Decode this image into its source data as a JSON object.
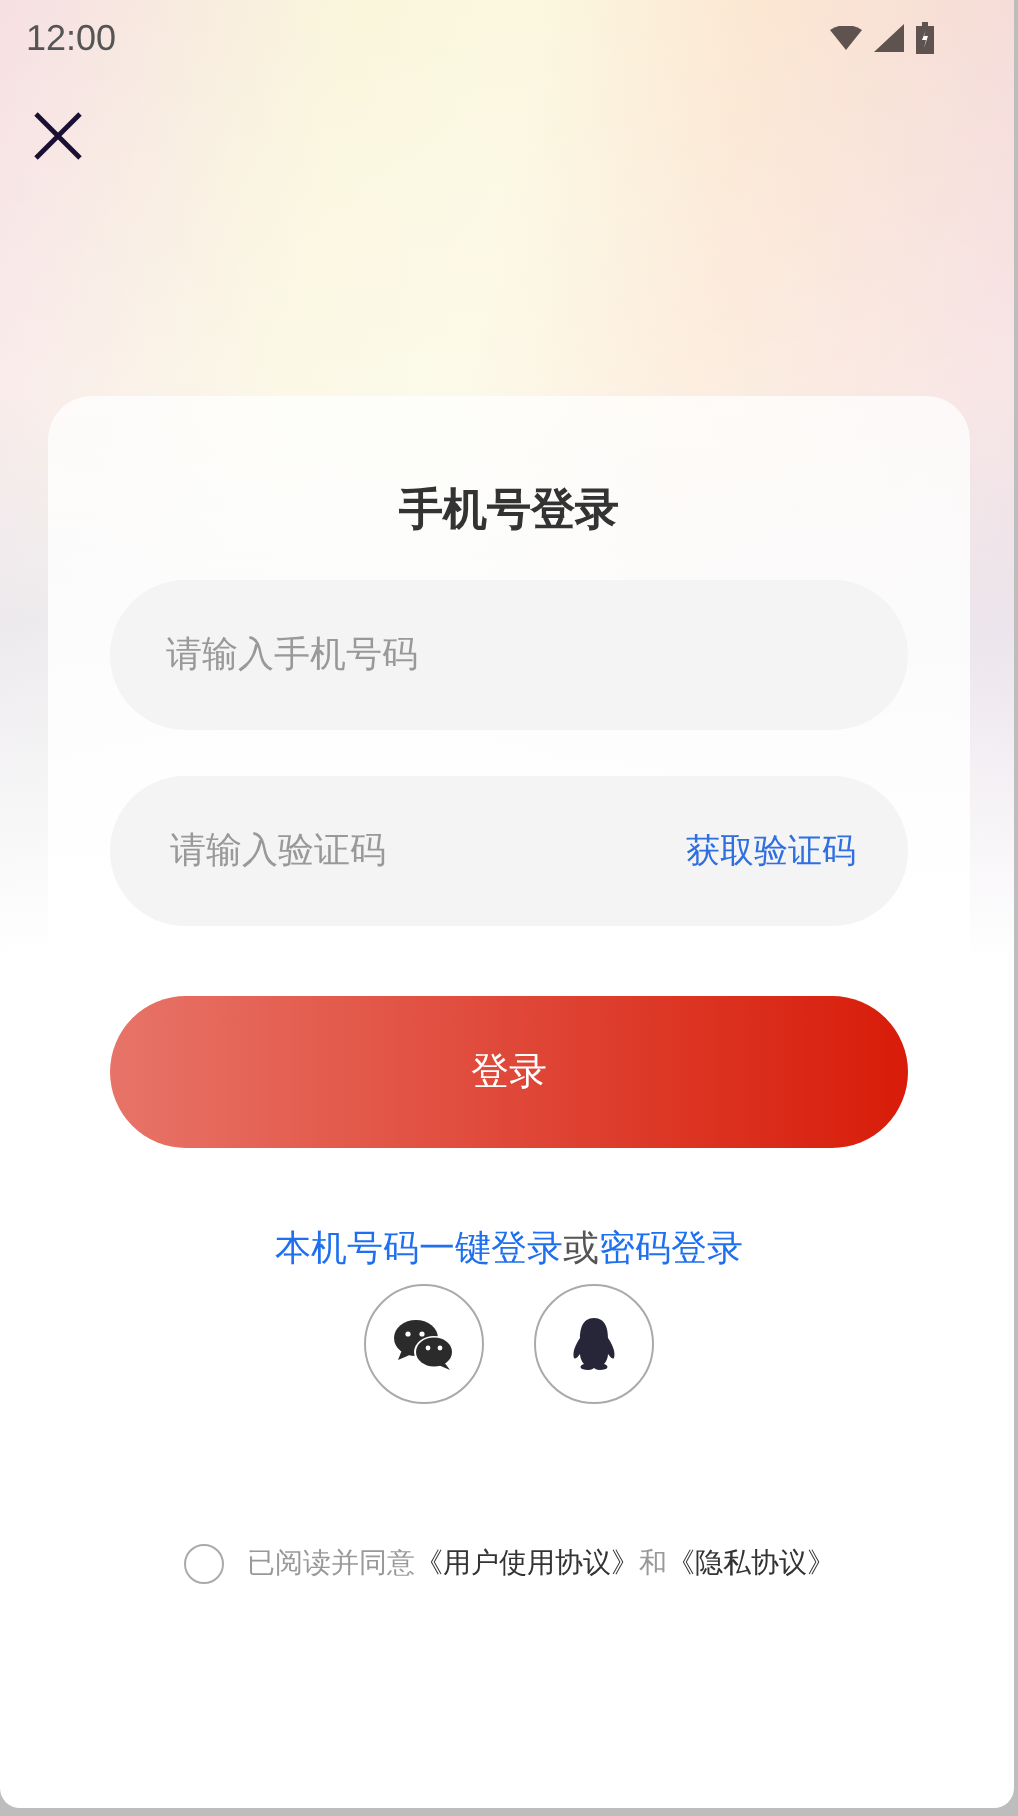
{
  "status_bar": {
    "time": "12:00"
  },
  "title": "手机号登录",
  "phone_field": {
    "placeholder": "请输入手机号码"
  },
  "code_field": {
    "placeholder": "请输入验证码",
    "action": "获取验证码"
  },
  "login_button": "登录",
  "alt_login": {
    "one_tap": "本机号码一键登录",
    "separator": "或",
    "password": "密码登录"
  },
  "social": [
    {
      "kind": "wechat"
    },
    {
      "kind": "qq"
    }
  ],
  "agreement": {
    "checked": false,
    "prefix": "已阅读并同意",
    "terms": "《用户使用协议》",
    "joiner": "和",
    "privacy": "《隐私协议》"
  }
}
